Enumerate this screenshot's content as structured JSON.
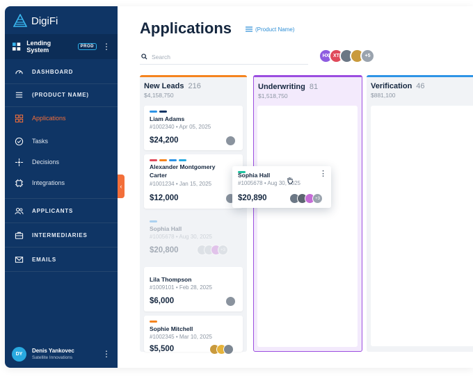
{
  "brand": {
    "name": "DigiFi"
  },
  "org": {
    "name": "Lending System",
    "env": "PROD"
  },
  "nav": {
    "dashboard": "DASHBOARD",
    "product": "(PRODUCT NAME)",
    "applications": "Applications",
    "tasks": "Tasks",
    "decisions": "Decisions",
    "integrations": "Integrations",
    "applicants": "APPLICANTS",
    "intermediaries": "INTERMEDIARIES",
    "emails": "EMAILS"
  },
  "user": {
    "initials": "DY",
    "name": "Denis Yankovec",
    "company": "Satellite Innovations"
  },
  "page": {
    "title": "Applications",
    "product_filter": "(Product Name)"
  },
  "search": {
    "placeholder": "Search"
  },
  "team": {
    "initials_1": "HX",
    "initials_2": "XT",
    "more": "+5"
  },
  "colors": {
    "accent": "#f36f3a",
    "navy": "#0f3565",
    "new_leads": "#f5841f",
    "underwriting": "#9b4de0",
    "verification": "#2e94e6"
  },
  "columns": {
    "new_leads": {
      "title": "New Leads",
      "count": "216",
      "amount": "$4,158,750"
    },
    "underwriting": {
      "title": "Underwriting",
      "count": "81",
      "amount": "$1,518,750"
    },
    "verification": {
      "title": "Verification",
      "count": "46",
      "amount": "$881,100"
    }
  },
  "cards": {
    "liam": {
      "name": "Liam Adams",
      "meta": "#1002340 • Apr 05, 2025",
      "amount": "$24,200"
    },
    "alex": {
      "name": "Alexander Montgomery Carter",
      "meta": "#1001234 • Jan 15, 2025",
      "amount": "$12,000"
    },
    "sophia_ghost": {
      "name": "Sophia Hall",
      "meta": "#1005678 • Aug 30, 2025",
      "amount": "$20,800",
      "more": "+3"
    },
    "lila": {
      "name": "Lila Thompson",
      "meta": "#1009101 • Feb 28, 2025",
      "amount": "$6,000"
    },
    "sophie": {
      "name": "Sophie Mitchell",
      "meta": "#1002345 • Mar 10, 2025",
      "amount": "$5,500"
    },
    "sophia_drag": {
      "name": "Sophia Hall",
      "meta": "#1005678 • Aug 30, 2025",
      "amount": "$20,890",
      "more": "+3"
    }
  }
}
